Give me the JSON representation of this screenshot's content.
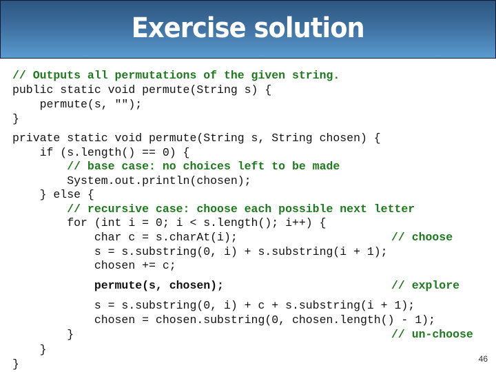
{
  "slide": {
    "title": "Exercise solution",
    "page_number": "46",
    "colors": {
      "header_top": "#2c5680",
      "header_bottom": "#5a9bd0",
      "comment": "#1f7a1f",
      "code": "#111111"
    }
  },
  "code": {
    "lines": [
      {
        "text": "// Outputs all permutations of the given string."
      },
      {
        "text": "public static void permute(String s) {"
      },
      {
        "text": "    permute(s, \"\");"
      },
      {
        "text": "}"
      },
      {
        "text": "private static void permute(String s, String chosen) {"
      },
      {
        "text": "    if (s.length() == 0) {"
      },
      {
        "text": "        // base case: no choices left to be made"
      },
      {
        "text": "        System.out.println(chosen);"
      },
      {
        "text": "    } else {"
      },
      {
        "text": "        // recursive case: choose each possible next letter"
      },
      {
        "text": "        for (int i = 0; i < s.length(); i++) {"
      },
      {
        "text": "            char c = s.charAt(i);"
      },
      {
        "text": "// choose"
      },
      {
        "text": "            s = s.substring(0, i) + s.substring(i + 1);"
      },
      {
        "text": "            chosen += c;"
      },
      {
        "text": "            permute(s, chosen);"
      },
      {
        "text": "// explore"
      },
      {
        "text": "            s = s.substring(0, i) + c + s.substring(i + 1);"
      },
      {
        "text": "            chosen = chosen.substring(0, chosen.length() - 1);"
      },
      {
        "text": "        }"
      },
      {
        "text": "// un-choose"
      },
      {
        "text": "    }"
      },
      {
        "text": "}"
      }
    ]
  }
}
